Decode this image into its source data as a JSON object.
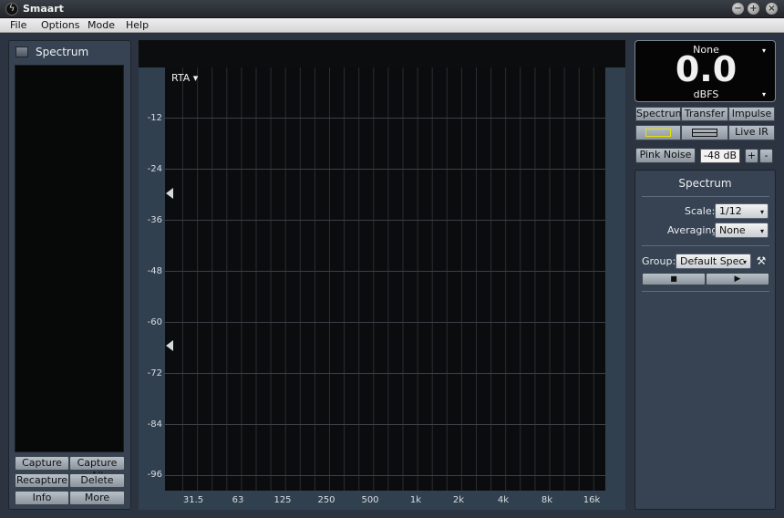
{
  "app": {
    "title": "Smaart"
  },
  "menu": [
    "File",
    "Options",
    "Mode",
    "Help"
  ],
  "window_controls": {
    "minimize": "−",
    "maximize": "+",
    "close": "×"
  },
  "left_panel": {
    "title": "Spectrum",
    "buttons": [
      "Capture",
      "Capture All",
      "Recapture",
      "Delete",
      "Info",
      "More"
    ]
  },
  "plot": {
    "mode_label": "RTA ▾",
    "y_ticks": [
      "-12",
      "-24",
      "-36",
      "-48",
      "-60",
      "-72",
      "-84",
      "-96"
    ],
    "x_ticks": [
      "31.5",
      "63",
      "125",
      "250",
      "500",
      "1k",
      "2k",
      "4k",
      "8k",
      "16k"
    ]
  },
  "meter": {
    "source": "None",
    "value": "0.0",
    "unit": "dBFS"
  },
  "mode_tabs": [
    "Spectrum",
    "Transfer",
    "Impulse"
  ],
  "live_ir": "Live IR",
  "pink_noise": {
    "label": "Pink Noise",
    "level": "-48 dB",
    "plus": "+",
    "minus": "-"
  },
  "spectrum_panel": {
    "title": "Spectrum",
    "scale_label": "Scale:",
    "scale_value": "1/12",
    "averaging_label": "Averaging:",
    "averaging_value": "None",
    "group_label": "Group:",
    "group_value": "Default Spec"
  },
  "colors": {
    "accent_yellow": "#e4e000",
    "panel": "#374352",
    "plot_bg": "#0b0c0d"
  }
}
